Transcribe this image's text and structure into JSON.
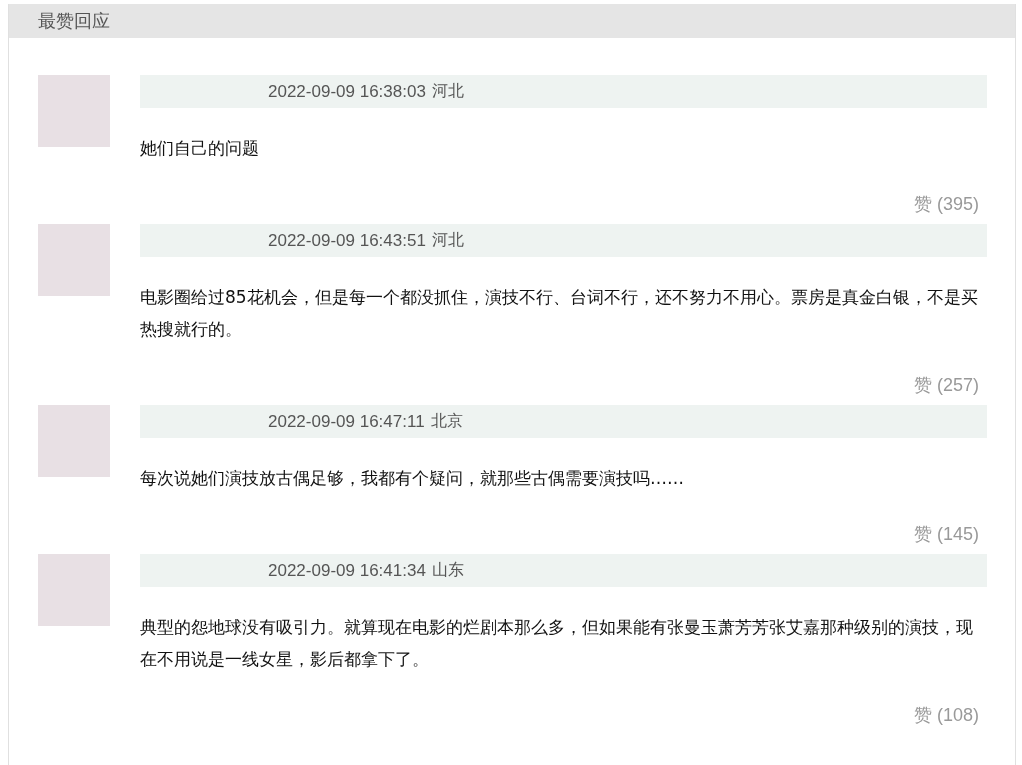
{
  "section_title": "最赞回应",
  "comments": [
    {
      "time": "2022-09-09 16:38:03",
      "location": "河北",
      "text": "她们自己的问题",
      "likes": "赞 (395)"
    },
    {
      "time": "2022-09-09 16:43:51",
      "location": "河北",
      "text": "电影圈给过85花机会，但是每一个都没抓住，演技不行、台词不行，还不努力不用心。票房是真金白银，不是买热搜就行的。",
      "likes": "赞 (257)"
    },
    {
      "time": "2022-09-09 16:47:11",
      "location": "北京",
      "text": "每次说她们演技放古偶足够，我都有个疑问，就那些古偶需要演技吗……",
      "likes": "赞 (145)"
    },
    {
      "time": "2022-09-09 16:41:34",
      "location": "山东",
      "text": "典型的怨地球没有吸引力。就算现在电影的烂剧本那么多，但如果能有张曼玉萧芳芳张艾嘉那种级别的演技，现在不用说是一线女星，影后都拿下了。",
      "likes": "赞 (108)"
    }
  ]
}
